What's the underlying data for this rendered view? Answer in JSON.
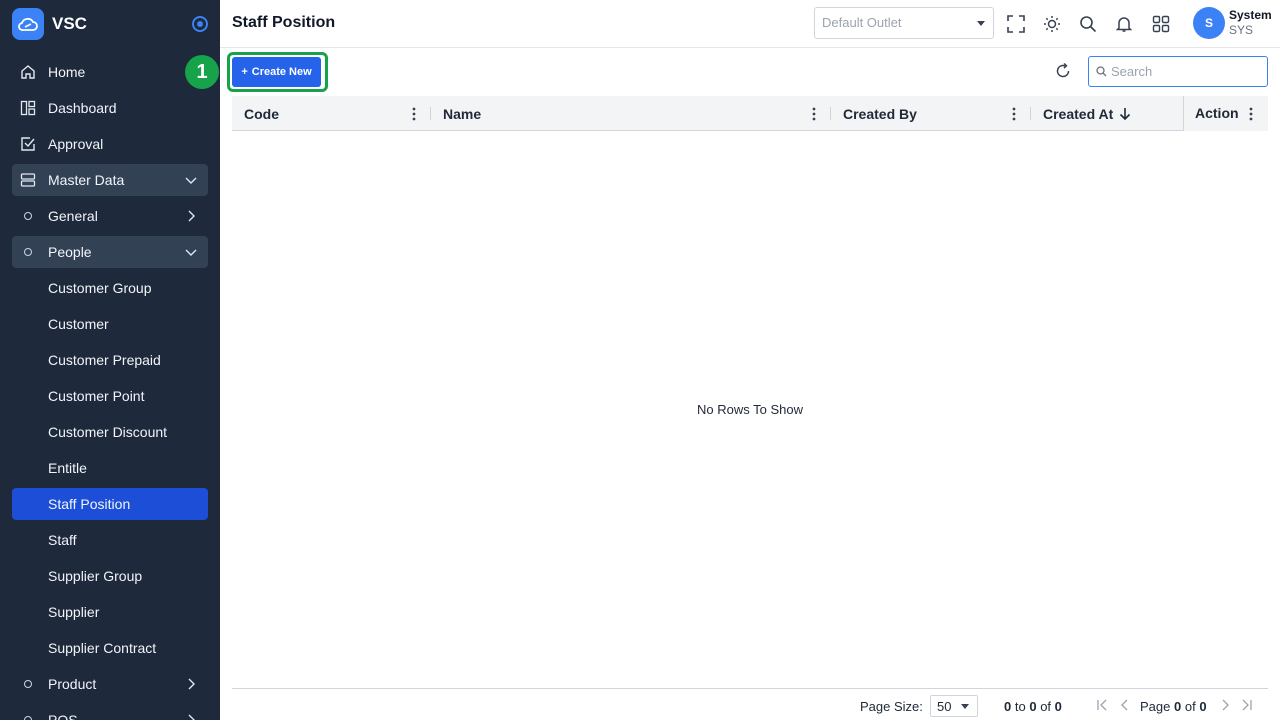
{
  "app": {
    "name": "VSC"
  },
  "sidebar": {
    "items": [
      {
        "label": "Home"
      },
      {
        "label": "Dashboard"
      },
      {
        "label": "Approval"
      },
      {
        "label": "Master Data"
      },
      {
        "label": "General"
      },
      {
        "label": "People"
      },
      {
        "label": "Customer Group"
      },
      {
        "label": "Customer"
      },
      {
        "label": "Customer Prepaid"
      },
      {
        "label": "Customer Point"
      },
      {
        "label": "Customer Discount"
      },
      {
        "label": "Entitle"
      },
      {
        "label": "Staff Position"
      },
      {
        "label": "Staff"
      },
      {
        "label": "Supplier Group"
      },
      {
        "label": "Supplier"
      },
      {
        "label": "Supplier Contract"
      },
      {
        "label": "Product"
      },
      {
        "label": "POS"
      }
    ],
    "active": "Staff Position"
  },
  "header": {
    "title": "Staff Position",
    "outlet_placeholder": "Default Outlet",
    "user": {
      "initial": "S",
      "name": "System",
      "code": "SYS"
    }
  },
  "toolbar": {
    "create_label": "Create New",
    "step_badge": "1",
    "search_placeholder": "Search"
  },
  "grid": {
    "columns": [
      "Code",
      "Name",
      "Created By",
      "Created At",
      "Action"
    ],
    "sort": {
      "column": "Created At",
      "direction": "desc"
    },
    "empty_message": "No Rows To Show"
  },
  "footer": {
    "page_size_label": "Page Size:",
    "page_size": "50",
    "range_from": "0",
    "range_to_label": "to",
    "range_to": "0",
    "range_of_label": "of",
    "range_total": "0",
    "page_label": "Page",
    "page_current": "0",
    "page_of_label": "of",
    "page_total": "0"
  },
  "colors": {
    "sidebar_bg": "#1e293b",
    "active_item": "#1d4ed8",
    "primary": "#2563eb",
    "highlight": "#16a34a"
  }
}
